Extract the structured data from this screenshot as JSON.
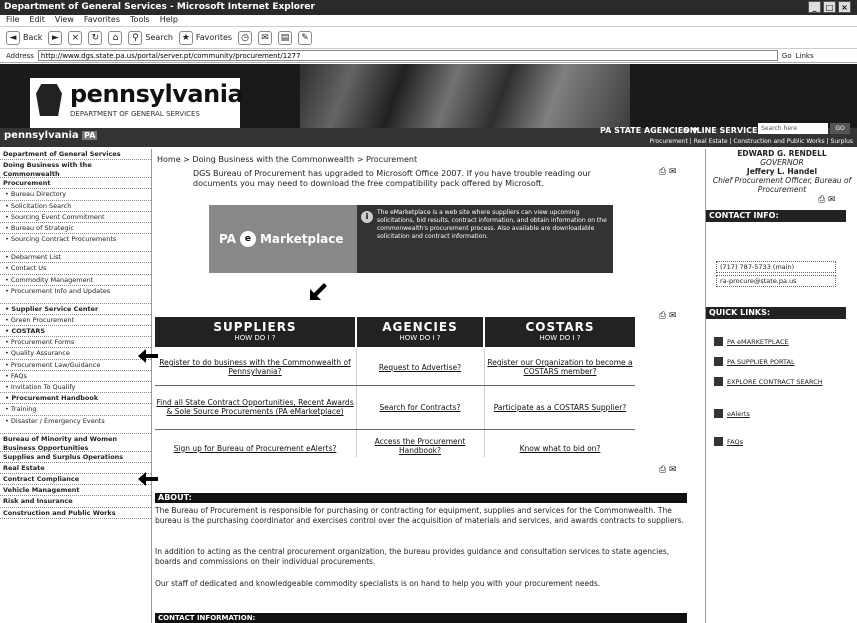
{
  "window": {
    "title": "Department of General Services - Microsoft Internet Explorer",
    "controls": [
      "_",
      "□",
      "×"
    ]
  },
  "menubar": [
    "File",
    "Edit",
    "View",
    "Favorites",
    "Tools",
    "Help"
  ],
  "toolbar": {
    "back": "Back",
    "search": "Search",
    "favorites": "Favorites"
  },
  "address": {
    "label": "Address",
    "url": "http://www.dgs.state.pa.us/portal/server.pt/community/procurement/1277",
    "go": "Go",
    "links": "Links"
  },
  "header": {
    "logo": "pennsylvania",
    "department": "DEPARTMENT OF GENERAL SERVICES",
    "pa_brand": "pennsylvania",
    "pa_badge": "PA",
    "agencies": "PA STATE AGENCIES ▼",
    "online_services": "ONLINE SERVICES ▼",
    "search_placeholder": "Search here",
    "search_go": "GO",
    "links": "Procurement | Real Estate | Construction and Public Works | Surplus"
  },
  "leftnav": [
    {
      "label": "Department of General Services",
      "style": "bold"
    },
    {
      "label": "Doing Business with the Commonwealth",
      "style": "bold tall"
    },
    {
      "label": "Procurement",
      "style": "bold"
    },
    {
      "label": "• Bureau Directory",
      "style": "sub"
    },
    {
      "label": "• Solicitation Search",
      "style": "sub"
    },
    {
      "label": "• Sourcing Event Commitment",
      "style": "sub"
    },
    {
      "label": "• Bureau of Strategic",
      "style": "sub"
    },
    {
      "label": "• Sourcing Contract Procurements",
      "style": "sub tall"
    },
    {
      "label": "• Debarment List",
      "style": "sub"
    },
    {
      "label": "• Contact Us",
      "style": "sub"
    },
    {
      "label": "• Commodity Management",
      "style": "sub"
    },
    {
      "label": "• Procurement Info and Updates",
      "style": "sub tall"
    },
    {
      "label": "• Supplier Service Center",
      "style": "sub bold"
    },
    {
      "label": "• Green Procurement",
      "style": "sub"
    },
    {
      "label": "• COSTARS",
      "style": "sub bold"
    },
    {
      "label": "• Procurement Forms",
      "style": "sub"
    },
    {
      "label": "• Quality Assurance",
      "style": "sub"
    },
    {
      "label": "• Procurement Law/Guidance",
      "style": "sub"
    },
    {
      "label": "• FAQs",
      "style": "sub"
    },
    {
      "label": "• Invitation To Qualify",
      "style": "sub"
    },
    {
      "label": "• Procurement Handbook",
      "style": "sub bold"
    },
    {
      "label": "• Training",
      "style": "sub"
    },
    {
      "label": "• Disaster / Emergency Events",
      "style": "sub tall"
    },
    {
      "label": "Bureau of Minority and Women Business Opportunities",
      "style": "bold tall"
    },
    {
      "label": "Supplies and Surplus Operations",
      "style": "bold"
    },
    {
      "label": "Real Estate",
      "style": "bold"
    },
    {
      "label": "Contract Compliance",
      "style": "bold"
    },
    {
      "label": "Vehicle Management",
      "style": "bold"
    },
    {
      "label": "Risk and Insurance",
      "style": "bold"
    },
    {
      "label": "Construction and Public Works",
      "style": "bold"
    }
  ],
  "main": {
    "breadcrumb": "Home > Doing Business with the Commonwealth > Procurement",
    "intro": "DGS Bureau of Procurement has upgraded to Microsoft Office 2007. If you have trouble reading our documents you may need to download the free compatibility pack offered by Microsoft.",
    "marketplace_logo_pa": "PA",
    "marketplace_logo_e": "e",
    "marketplace_logo_text": "Marketplace",
    "marketplace_info": "The eMarketplace is a web site where suppliers can view upcoming solicitations, bid results, contract information, and obtain information on the commonwealth's procurement process. Also available are downloadable solicitation and contract information.",
    "columns": [
      {
        "title": "SUPPLIERS",
        "sub": "HOW DO I ?"
      },
      {
        "title": "AGENCIES",
        "sub": "HOW DO I ?"
      },
      {
        "title": "COSTARS",
        "sub": "HOW DO I ?"
      }
    ],
    "cells": [
      [
        "Register to do business with the Commonwealth of Pennsylvania?",
        "Find all State Contract Opportunities, Recent Awards & Sole Source Procurements (PA eMarketplace)",
        "Sign up for Bureau of Procurement eAlerts?"
      ],
      [
        "Request to Advertise?",
        "Search for Contracts?",
        "Access the Procurement Handbook?"
      ],
      [
        "Register our Organization to become a COSTARS member?",
        "Participate as a COSTARS Supplier?",
        "Know what to bid on?"
      ]
    ],
    "about_head": "ABOUT:",
    "about_p1": "The Bureau of Procurement is responsible for purchasing or contracting for equipment, supplies and services for the Commonwealth. The bureau is the purchasing coordinator and exercises control over the acquisition of materials and services, and awards contracts to suppliers.",
    "about_p2": "In addition to acting as the central procurement organization, the bureau provides guidance and consultation services to state agencies, boards and commissions on their individual procurements.",
    "about_p3": "Our staff of dedicated and knowledgeable commodity specialists is on hand to help you with your procurement needs.",
    "contact_head": "CONTACT INFORMATION:"
  },
  "right": {
    "official_name": "EDWARD G. RENDELL",
    "official_role": "GOVERNOR",
    "officer_name": "Jeffery L. Handel",
    "officer_title": "Chief Procurement Officer, Bureau of Procurement",
    "contact_head": "CONTACT INFO:",
    "phone": "(717) 787-5733 (main)",
    "email": "ra-procure@state.pa.us",
    "quick_head": "QUICK LINKS:",
    "quick_links": [
      "PA eMARKETPLACE",
      "PA SUPPLIER PORTAL",
      "EXPLORE CONTRACT SEARCH",
      "eAlerts",
      "FAQs"
    ]
  }
}
